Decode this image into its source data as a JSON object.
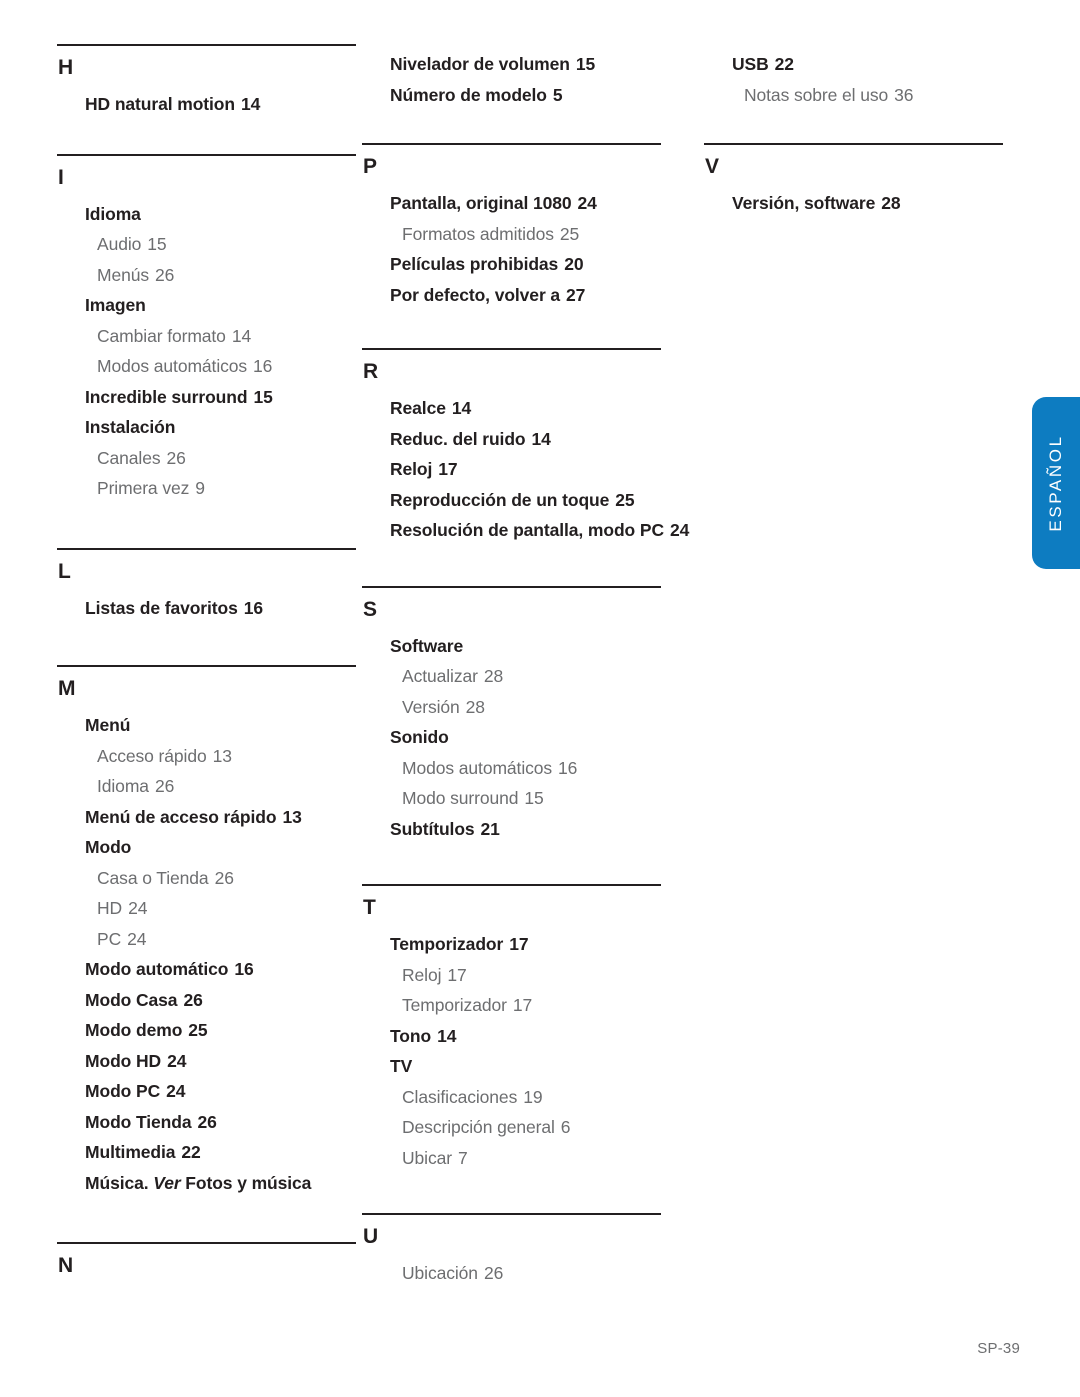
{
  "document": {
    "type": "index",
    "footer_label": "SP-39",
    "side_tab_label": "ESPAÑOL",
    "accent_color": "#0d7cc1",
    "text_color": "#231f20",
    "subentry_color": "#6d6e70",
    "rule_color": "#231f20"
  },
  "columns": [
    {
      "id": "column-1",
      "sections": [
        {
          "letter": "H",
          "entries": [
            {
              "level": 1,
              "label": "HD natural motion",
              "page": "14"
            }
          ]
        },
        {
          "letter": "I",
          "entries": [
            {
              "level": 1,
              "label": "Idioma",
              "page": ""
            },
            {
              "level": 2,
              "label": "Audio",
              "page": "15"
            },
            {
              "level": 2,
              "label": "Menús",
              "page": "26"
            },
            {
              "level": 1,
              "label": "Imagen",
              "page": ""
            },
            {
              "level": 2,
              "label": "Cambiar formato",
              "page": "14"
            },
            {
              "level": 2,
              "label": "Modos automáticos",
              "page": "16"
            },
            {
              "level": 1,
              "label": "Incredible surround",
              "page": "15"
            },
            {
              "level": 1,
              "label": "Instalación",
              "page": ""
            },
            {
              "level": 2,
              "label": "Canales",
              "page": "26"
            },
            {
              "level": 2,
              "label": "Primera vez",
              "page": "9"
            }
          ]
        },
        {
          "letter": "L",
          "entries": [
            {
              "level": 1,
              "label": "Listas de favoritos",
              "page": "16"
            }
          ]
        },
        {
          "letter": "M",
          "entries": [
            {
              "level": 1,
              "label": "Menú",
              "page": ""
            },
            {
              "level": 2,
              "label": "Acceso rápido",
              "page": "13"
            },
            {
              "level": 2,
              "label": "Idioma",
              "page": "26"
            },
            {
              "level": 1,
              "label": "Menú de acceso rápido",
              "page": "13"
            },
            {
              "level": 1,
              "label": "Modo",
              "page": ""
            },
            {
              "level": 2,
              "label": "Casa o Tienda",
              "page": "26"
            },
            {
              "level": 2,
              "label": "HD",
              "page": "24"
            },
            {
              "level": 2,
              "label": "PC",
              "page": "24"
            },
            {
              "level": 1,
              "label": "Modo automático",
              "page": "16"
            },
            {
              "level": 1,
              "label": "Modo Casa",
              "page": "26"
            },
            {
              "level": 1,
              "label": "Modo demo",
              "page": "25"
            },
            {
              "level": 1,
              "label": "Modo HD",
              "page": "24"
            },
            {
              "level": 1,
              "label": "Modo PC",
              "page": "24"
            },
            {
              "level": 1,
              "label": "Modo Tienda",
              "page": "26"
            },
            {
              "level": 1,
              "label": "Multimedia",
              "page": "22"
            },
            {
              "level": 1,
              "label": "Música. ",
              "italic": "Ver",
              "label_after": " Fotos y música",
              "page": ""
            }
          ]
        },
        {
          "letter": "N",
          "entries": []
        }
      ]
    },
    {
      "id": "column-2",
      "top_entries": [
        {
          "level": 1,
          "label": "Nivelador de volumen",
          "page": "15"
        },
        {
          "level": 1,
          "label": "Número de modelo",
          "page": "5"
        }
      ],
      "sections": [
        {
          "letter": "P",
          "entries": [
            {
              "level": 1,
              "label": "Pantalla, original 1080",
              "page": "24"
            },
            {
              "level": 2,
              "label": "Formatos admitidos",
              "page": "25"
            },
            {
              "level": 1,
              "label": "Películas prohibidas",
              "page": "20"
            },
            {
              "level": 1,
              "label": "Por defecto, volver a",
              "page": "27"
            }
          ]
        },
        {
          "letter": "R",
          "entries": [
            {
              "level": 1,
              "label": "Realce",
              "page": "14"
            },
            {
              "level": 1,
              "label": "Reduc. del ruido",
              "page": "14"
            },
            {
              "level": 1,
              "label": "Reloj",
              "page": "17"
            },
            {
              "level": 1,
              "label": "Reproducción de un toque",
              "page": "25"
            },
            {
              "level": 1,
              "label": "Resolución de pantalla, modo PC",
              "page": "24"
            }
          ]
        },
        {
          "letter": "S",
          "entries": [
            {
              "level": 1,
              "label": "Software",
              "page": ""
            },
            {
              "level": 2,
              "label": "Actualizar",
              "page": "28"
            },
            {
              "level": 2,
              "label": "Versión",
              "page": "28"
            },
            {
              "level": 1,
              "label": "Sonido",
              "page": ""
            },
            {
              "level": 2,
              "label": "Modos automáticos",
              "page": "16"
            },
            {
              "level": 2,
              "label": "Modo surround",
              "page": "15"
            },
            {
              "level": 1,
              "label": "Subtítulos",
              "page": "21"
            }
          ]
        },
        {
          "letter": "T",
          "entries": [
            {
              "level": 1,
              "label": "Temporizador",
              "page": "17"
            },
            {
              "level": 2,
              "label": "Reloj",
              "page": "17"
            },
            {
              "level": 2,
              "label": "Temporizador",
              "page": "17"
            },
            {
              "level": 1,
              "label": "Tono",
              "page": "14"
            },
            {
              "level": 1,
              "label": "TV",
              "page": ""
            },
            {
              "level": 2,
              "label": "Clasificaciones",
              "page": "19"
            },
            {
              "level": 2,
              "label": "Descripción general",
              "page": "6"
            },
            {
              "level": 2,
              "label": "Ubicar",
              "page": "7"
            }
          ]
        },
        {
          "letter": "U",
          "entries": [
            {
              "level": 2,
              "label": "Ubicación",
              "page": "26"
            }
          ]
        }
      ]
    },
    {
      "id": "column-3",
      "top_entries": [
        {
          "level": 1,
          "label": "USB",
          "page": "22"
        },
        {
          "level": 2,
          "label": "Notas sobre el uso",
          "page": "36"
        }
      ],
      "sections": [
        {
          "letter": "V",
          "entries": [
            {
              "level": 1,
              "label": "Versión, software",
              "page": "28"
            }
          ]
        }
      ]
    }
  ]
}
